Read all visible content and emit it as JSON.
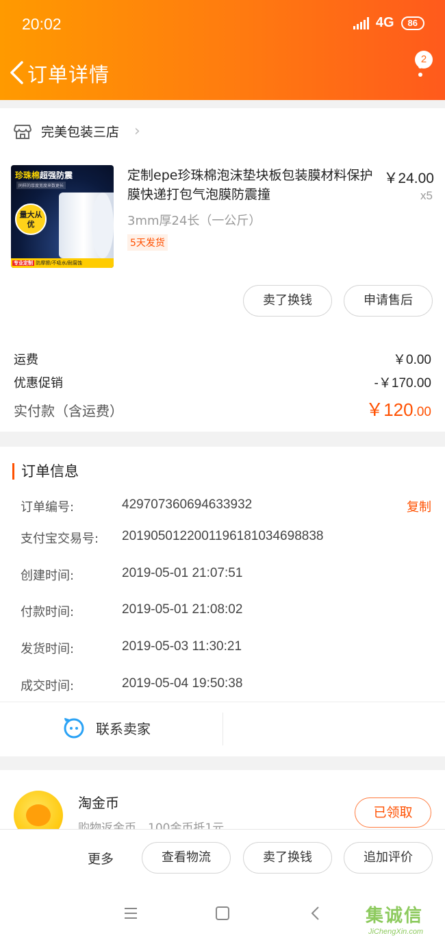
{
  "status_bar": {
    "time": "20:02",
    "network": "4G",
    "battery": "86"
  },
  "header": {
    "title": "订单详情",
    "badge_count": "2"
  },
  "shop": {
    "name": "完美包装三店"
  },
  "product": {
    "title": "定制epe珍珠棉泡沫垫块板包装膜材料保护膜快递打包气泡膜防震撞",
    "spec": "3mm厚24长（一公斤）",
    "ship_tag": "5天发货",
    "price": "￥24.00",
    "qty": "x5",
    "image_text": {
      "title_a": "珍珠棉",
      "title_b": "超强防震",
      "sub": "同样的厚度宽度来数更长",
      "bubble": "量大从优",
      "foot_tag": "专业定制",
      "foot_text": "防摩擦/不吸水/耐腐蚀"
    }
  },
  "actions": {
    "sell": "卖了换钱",
    "after_sale": "申请售后"
  },
  "fees": {
    "shipping_label": "运费",
    "shipping_value": "￥0.00",
    "discount_label": "优惠促销",
    "discount_value": "-￥170.00",
    "paid_label": "实付款（含运费）",
    "paid_value_main": "￥120",
    "paid_value_cents": ".00"
  },
  "order_info": {
    "title": "订单信息",
    "order_no_label": "订单编号:",
    "order_no": "429707360694633932",
    "copy": "复制",
    "alipay_label": "支付宝交易号:",
    "alipay_no": "2019050122001196181034698838",
    "created_label": "创建时间:",
    "created": "2019-05-01 21:07:51",
    "paid_label": "付款时间:",
    "paid": "2019-05-01 21:08:02",
    "shipped_label": "发货时间:",
    "shipped": "2019-05-03 11:30:21",
    "done_label": "成交时间:",
    "done": "2019-05-04 19:50:38",
    "contact": "联系卖家"
  },
  "coins": {
    "title": "淘金币",
    "subtitle": "购物返金币，100金币抵1元",
    "claimed": "已领取"
  },
  "bottom_bar": {
    "more": "更多",
    "logistics": "查看物流",
    "sell": "卖了换钱",
    "review": "追加评价"
  },
  "watermark": {
    "text": "集诚信",
    "sub": "JiChengXin.com"
  },
  "colors": {
    "accent": "#ff5000",
    "header_start": "#ff9a00",
    "header_end": "#ff5a1c"
  }
}
